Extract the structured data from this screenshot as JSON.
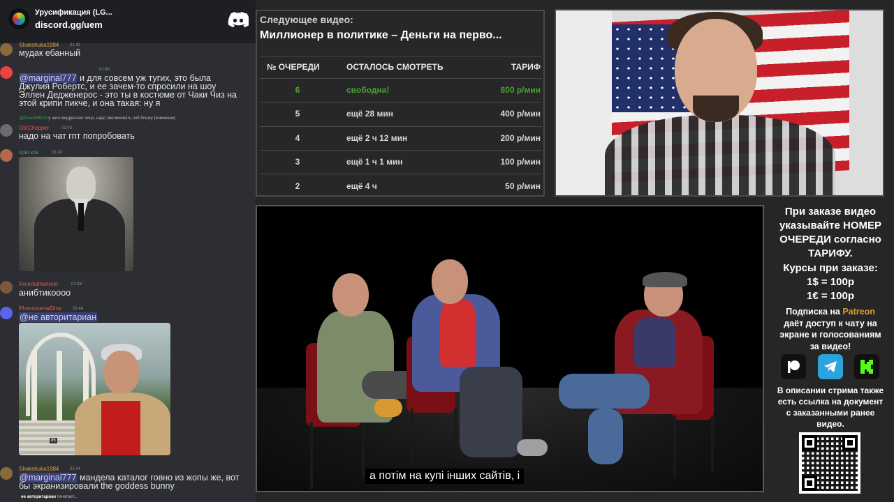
{
  "discord": {
    "server_name": "Урусификация (LG...",
    "invite": "discord.gg/uem",
    "messages": [
      {
        "user": "Shakshuka1984",
        "time": "01:43",
        "text": "мудак ебанный",
        "color": "#d4a64a"
      },
      {
        "mention": "@marginal777",
        "time": "01:43",
        "lines": [
          "и для совсем уж тугих, это была",
          "Джулия Робертс, и ее зачем-то спросили на шоу",
          "Эллен Дедженерос - это ты в костюме от Чаки Чиз на",
          "этой крипи пикче, и она такая: ну я"
        ]
      },
      {
        "reply_user": "@ZoranWRLD",
        "reply_text": "у него квадратное лицо, надо увеличивать лоб бошку",
        "reply_edit": "(изменено)",
        "user": "OldChopper",
        "time": "01:43",
        "text": "надо на чат гпт попробовать",
        "color": "#e05a4b"
      },
      {
        "user": "хрю кок",
        "time": "01:43",
        "color": "#3ba55c"
      },
      {
        "user": "Rennteilnehmer",
        "time": "01:43",
        "text": "анибтикоооо",
        "color": "#e05a4b"
      },
      {
        "user": "PhenomenalDine",
        "time": "01:44",
        "mention": "@не авторитариан",
        "color": "#e05a4b"
      },
      {
        "user": "Shakshuka1984",
        "time": "01:44",
        "mention": "@marginal777",
        "text": "мандела каталог говно из жопы же, вот",
        "text2": "бы экранизировали the goddess bunny",
        "color": "#d4a64a"
      }
    ],
    "typing_user": "не авторитариан",
    "typing_text": "печатает..."
  },
  "queue": {
    "label": "Следующее видео:",
    "title": "Миллионер в политике – Деньги на перво...",
    "headers": {
      "num": "№ ОЧЕРЕДИ",
      "remain": "ОСТАЛОСЬ СМОТРЕТЬ",
      "rate": "ТАРИФ"
    },
    "rows": [
      {
        "num": "6",
        "remain": "свободна!",
        "rate": "800 р/мин"
      },
      {
        "num": "5",
        "remain": "ещё 28 мин",
        "rate": "400 р/мин"
      },
      {
        "num": "4",
        "remain": "ещё 2 ч 12 мин",
        "rate": "200 р/мин"
      },
      {
        "num": "3",
        "remain": "ещё 1 ч 1 мин",
        "rate": "100 р/мин"
      },
      {
        "num": "2",
        "remain": "ещё 4 ч",
        "rate": "50 р/мин"
      }
    ]
  },
  "video": {
    "subtitle": "а потім на купі інших сайтів, і"
  },
  "info": {
    "order_lines": [
      "При заказе видео",
      "указывайте НОМЕР",
      "ОЧЕРЕДИ согласно",
      "ТАРИФУ."
    ],
    "rates_title": "Курсы при заказе:",
    "rate_usd": "1$ = 100р",
    "rate_eur": "1€ = 100р",
    "sub_prefix": "Подписка на ",
    "sub_patreon": "Patreon",
    "sub_lines": [
      "даёт доступ к чату на",
      "экране и голосованиям",
      "за видео!"
    ],
    "doc_lines": [
      "В описании стрима также",
      "есть ссылка на документ",
      "с заказанными ранее",
      "видео."
    ]
  },
  "colors": {
    "free_green": "#4aa12f",
    "patreon_gold": "#d7a02b",
    "telegram_blue": "#2aa3de",
    "kick_green": "#53fc18",
    "mention_bg": "#5865f2"
  },
  "icons": [
    "discord-logo-icon",
    "patreon-icon",
    "telegram-icon",
    "kick-icon",
    "qr-code"
  ]
}
